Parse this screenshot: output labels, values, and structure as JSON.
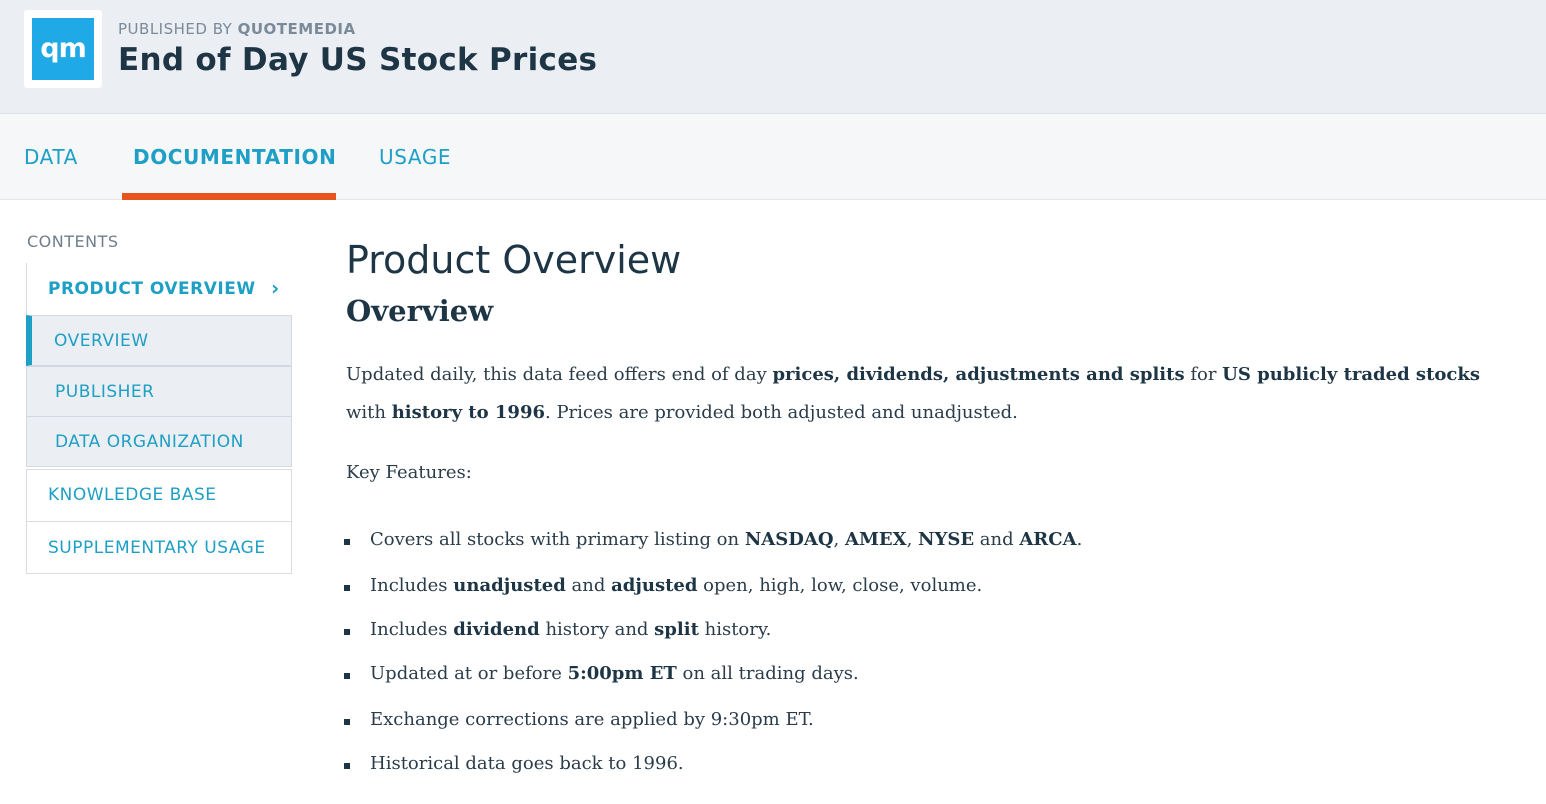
{
  "header": {
    "logo_text": "qm",
    "published_by_prefix": "PUBLISHED BY",
    "publisher": "QUOTEMEDIA",
    "title": "End of Day US Stock Prices"
  },
  "tabs": [
    {
      "label": "DATA",
      "active": false
    },
    {
      "label": "DOCUMENTATION",
      "active": true
    },
    {
      "label": "USAGE",
      "active": false
    }
  ],
  "sidebar": {
    "contents_label": "CONTENTS",
    "product_overview": "PRODUCT OVERVIEW",
    "sub_items": [
      {
        "label": "OVERVIEW",
        "active": true
      },
      {
        "label": "PUBLISHER",
        "active": false
      },
      {
        "label": "DATA ORGANIZATION",
        "active": false
      }
    ],
    "knowledge_base": "KNOWLEDGE BASE",
    "supplementary_usage": "SUPPLEMENTARY USAGE"
  },
  "main": {
    "heading": "Product Overview",
    "subheading": "Overview",
    "para_parts": [
      "Updated daily, this data feed offers end of day ",
      "prices, dividends, adjustments and splits",
      " for ",
      "US publicly traded stocks",
      " with ",
      "history to 1996",
      ". Prices are provided both adjusted and unadjusted."
    ],
    "key_features_label": "Key Features:",
    "bullets": {
      "b1": [
        "Covers all stocks with primary listing on ",
        "NASDAQ",
        ", ",
        "AMEX",
        ", ",
        "NYSE",
        " and ",
        "ARCA",
        "."
      ],
      "b2": [
        "Includes ",
        "unadjusted",
        " and ",
        "adjusted",
        " open, high, low, close, volume."
      ],
      "b3": [
        "Includes ",
        "dividend",
        " history and ",
        "split",
        " history."
      ],
      "b4": [
        "Updated at or before ",
        "5:00pm ET",
        " on all trading days."
      ],
      "b5": [
        "Exchange corrections are applied by 9:30pm ET."
      ],
      "b6": [
        "Historical data goes back to 1996."
      ]
    }
  },
  "colors": {
    "accent": "#1e9fc6",
    "tab_underline": "#e8521f",
    "logo_bg": "#1fa9e6",
    "text_dark": "#1d3545",
    "header_bg": "#ebeef2"
  }
}
